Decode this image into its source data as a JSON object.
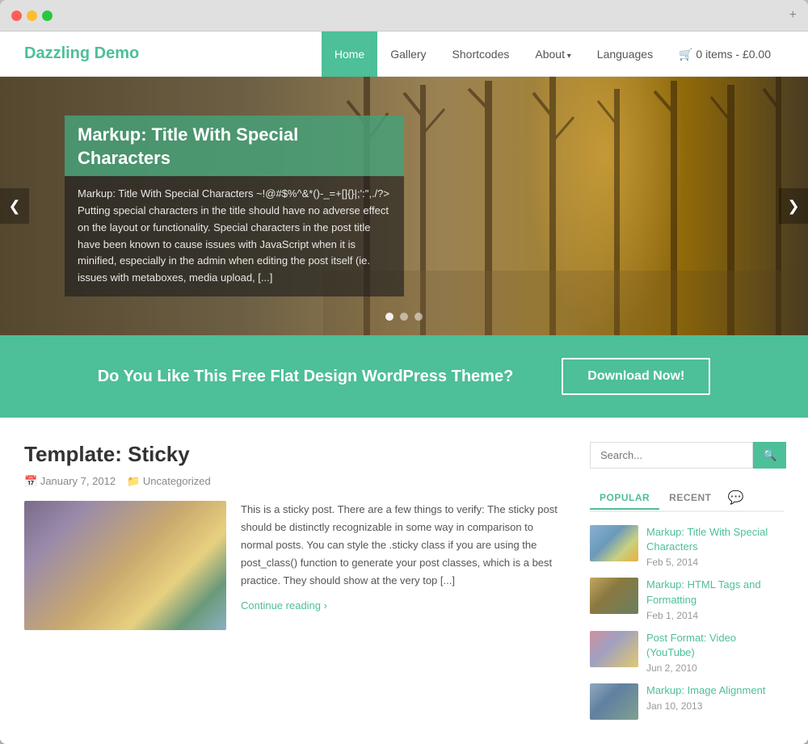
{
  "browser": {
    "plus_label": "+"
  },
  "header": {
    "logo": "Dazzling Demo",
    "nav": [
      {
        "label": "Home",
        "active": true
      },
      {
        "label": "Gallery",
        "active": false
      },
      {
        "label": "Shortcodes",
        "active": false
      },
      {
        "label": "About",
        "active": false,
        "has_arrow": true
      },
      {
        "label": "Languages",
        "active": false
      },
      {
        "label": "🛒 0 items - £0.00",
        "active": false
      }
    ]
  },
  "hero": {
    "title": "Markup: Title With Special Characters",
    "text": "Markup: Title With Special Characters ~!@#$%^&*()-_=+[]{}|;':\",./?> Putting special characters in the title should have no adverse effect on the layout or functionality. Special characters in the post title have been known to cause issues with JavaScript when it is minified, especially in the admin when editing the post itself (ie. issues with metaboxes, media upload, [...]",
    "arrow_left": "❮",
    "arrow_right": "❯"
  },
  "cta": {
    "text": "Do You Like This Free Flat Design WordPress Theme?",
    "button_label": "Download Now!"
  },
  "post": {
    "title": "Template: Sticky",
    "meta_date": "January 7, 2012",
    "meta_category": "Uncategorized",
    "excerpt": "This is a sticky post. There are a few things to verify: The sticky post should be distinctly recognizable in some way in comparison to normal posts. You can style the .sticky class if you are using the post_class() function to generate your post classes, which is a best practice. They should show at the very top [...]",
    "continue_label": "Continue reading"
  },
  "sidebar": {
    "search_placeholder": "Search...",
    "search_btn": "🔍",
    "tabs": [
      {
        "label": "POPULAR",
        "active": true
      },
      {
        "label": "RECENT",
        "active": false
      }
    ],
    "tab_icon": "💬",
    "posts": [
      {
        "title": "Markup: Title With Special Characters",
        "date": "Feb 5, 2014",
        "thumb": "thumb-1"
      },
      {
        "title": "Markup: HTML Tags and Formatting",
        "date": "Feb 1, 2014",
        "thumb": "thumb-2"
      },
      {
        "title": "Post Format: Video (YouTube)",
        "date": "Jun 2, 2010",
        "thumb": "thumb-3"
      },
      {
        "title": "Markup: Image Alignment",
        "date": "Jan 10, 2013",
        "thumb": "thumb-4"
      }
    ]
  }
}
